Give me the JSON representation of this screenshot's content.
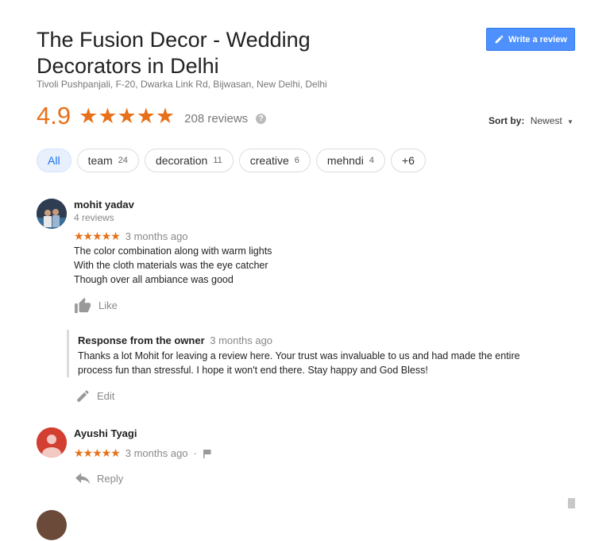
{
  "business": {
    "title": "The Fusion Decor - Wedding Decorators in Delhi",
    "address": "Tivoli Pushpanjali, F-20, Dwarka Link Rd, Bijwasan, New Delhi, Delhi",
    "rating": "4.9",
    "stars": "★★★★★",
    "review_count": "208 reviews"
  },
  "write_review_label": "Write a review",
  "sort": {
    "label": "Sort by:",
    "value": "Newest"
  },
  "chips": [
    {
      "label": "All",
      "count": ""
    },
    {
      "label": "team",
      "count": "24"
    },
    {
      "label": "decoration",
      "count": "11"
    },
    {
      "label": "creative",
      "count": "6"
    },
    {
      "label": "mehndi",
      "count": "4"
    },
    {
      "label": "+6",
      "count": ""
    }
  ],
  "reviews": [
    {
      "name": "mohit yadav",
      "sub": "4 reviews",
      "stars": "★★★★★",
      "time": "3 months ago",
      "text_lines": [
        "The color combination along with warm lights",
        "With the cloth materials was the eye catcher",
        "Though over all ambiance was good"
      ],
      "like_label": "Like",
      "owner_response": {
        "heading": "Response from the owner",
        "time": "3 months ago",
        "line1": "Thanks a lot Mohit for leaving a review here. Your trust was invaluable to us and had made the entire",
        "line2": "process fun than stressful. I hope it won't end there. Stay happy and God Bless!"
      },
      "edit_label": "Edit"
    },
    {
      "name": "Ayushi Tyagi",
      "stars": "★★★★★",
      "time": "3 months ago",
      "separator": "·",
      "reply_label": "Reply"
    }
  ],
  "colors": {
    "accent": "#e7711b",
    "button": "#4d90fe",
    "avatar2": "#d23f31"
  }
}
